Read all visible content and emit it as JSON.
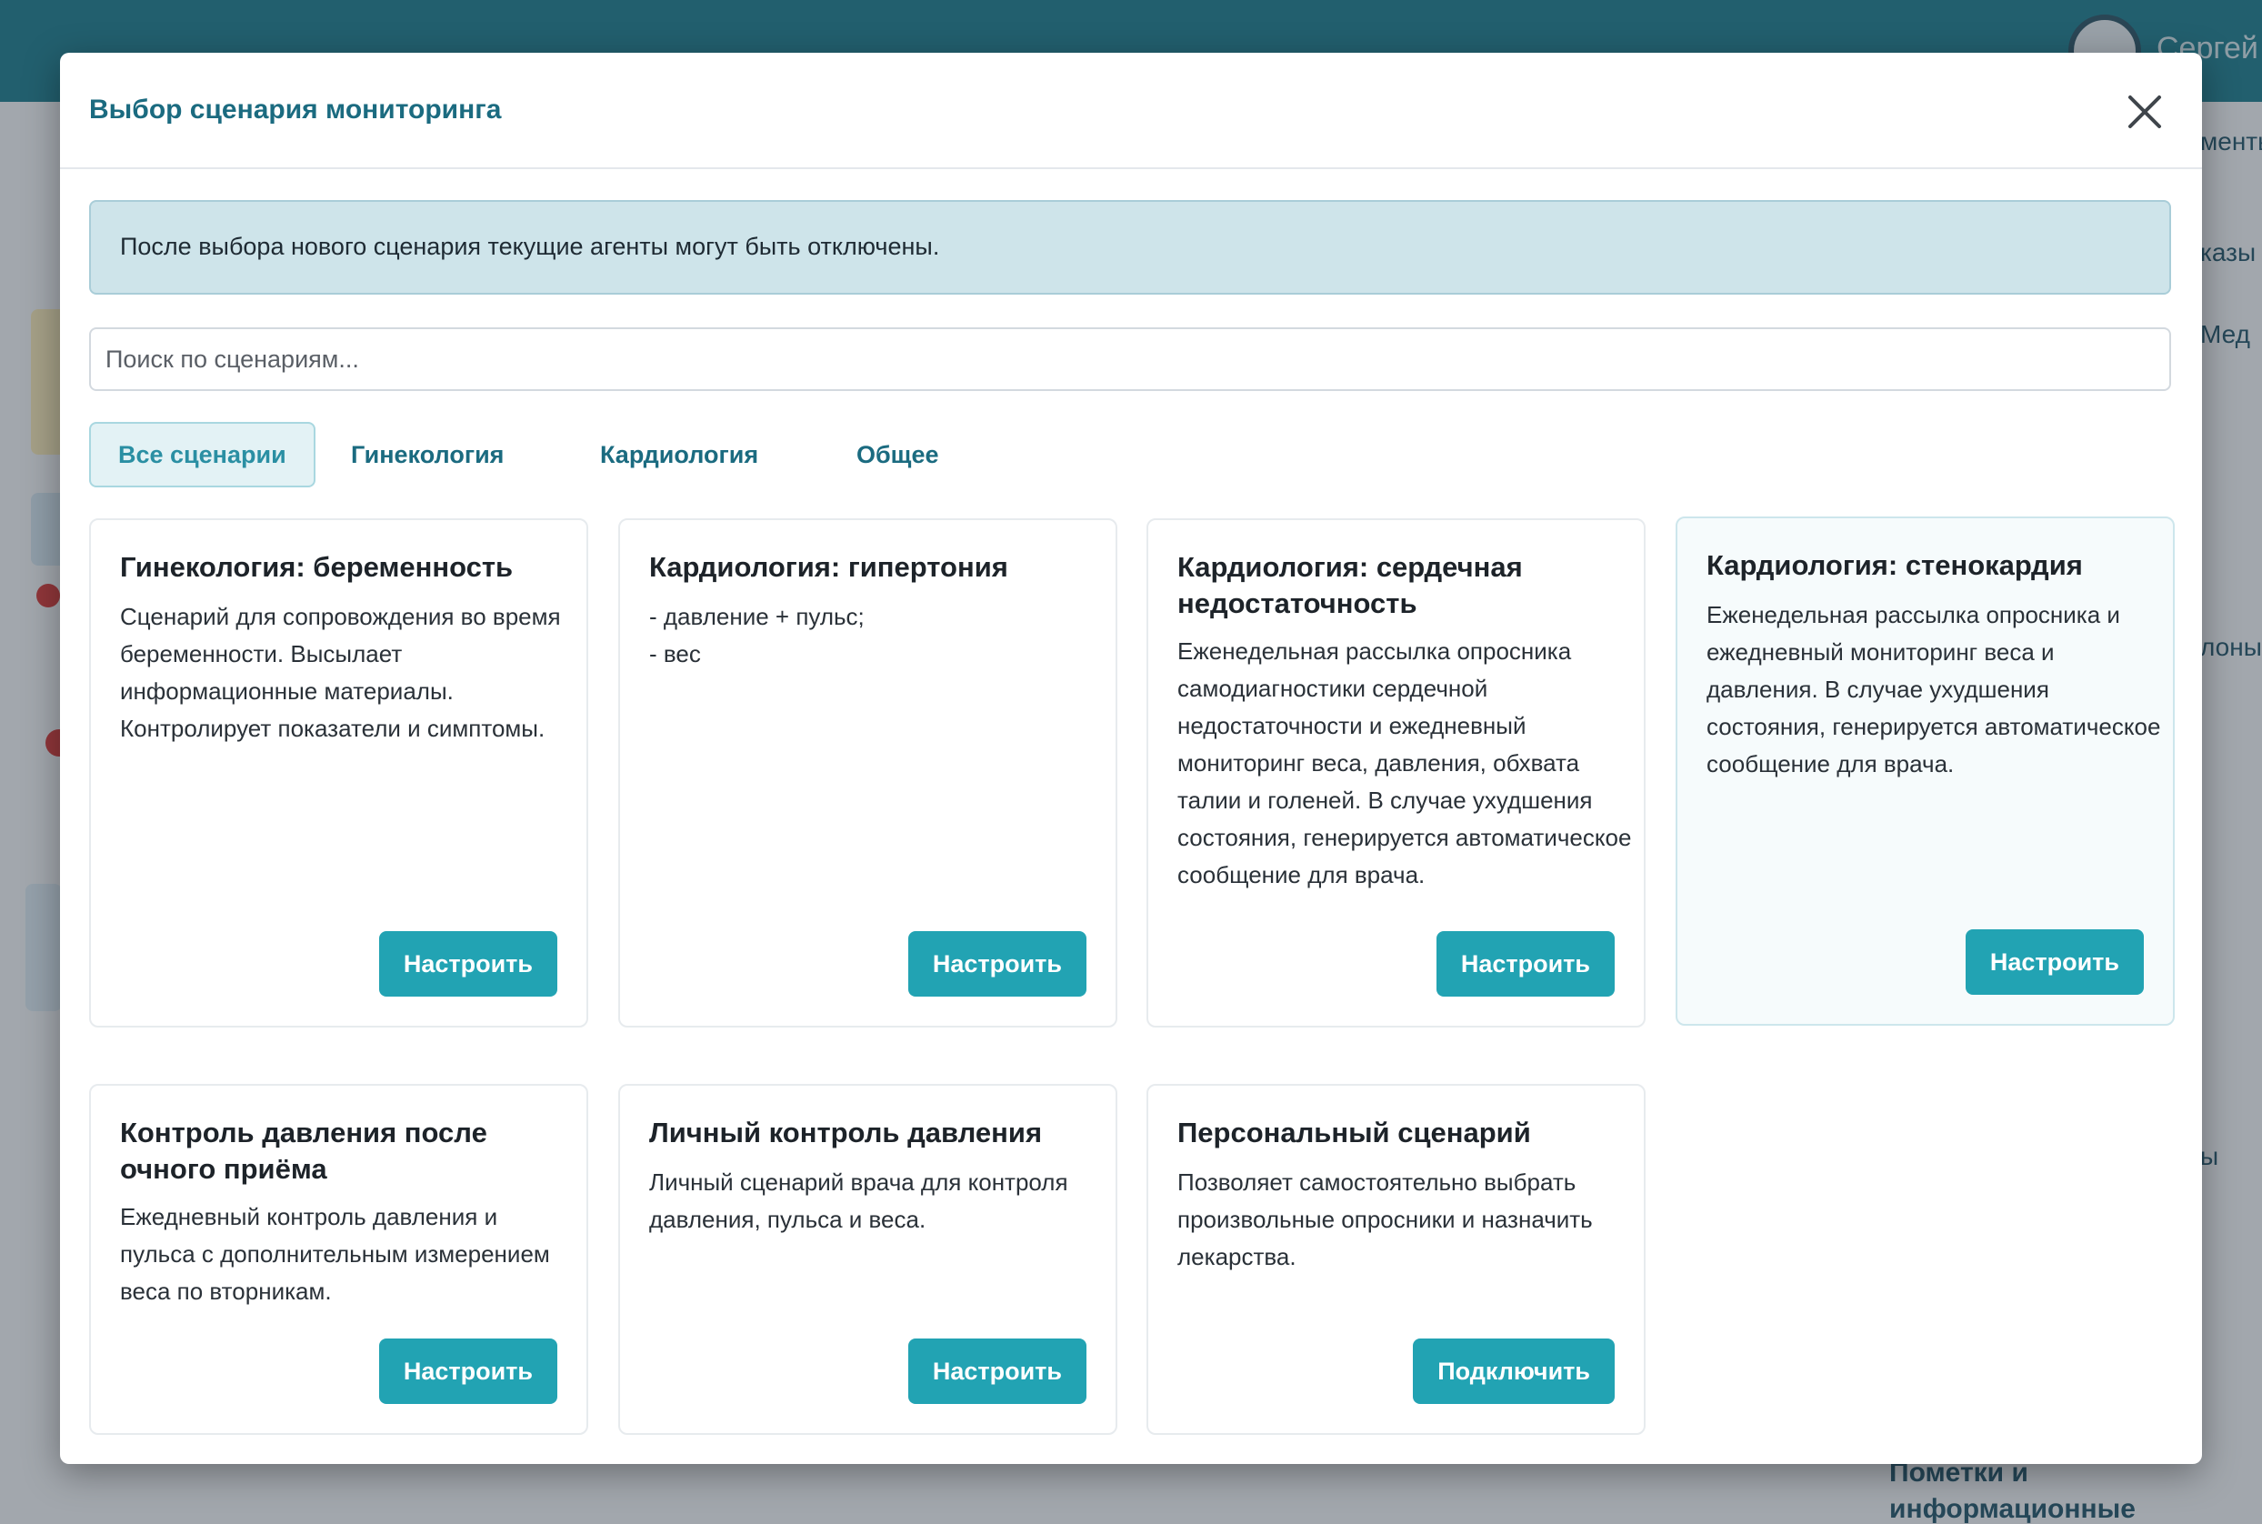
{
  "background": {
    "user_name": "Сергей",
    "side_texts": [
      "менты",
      "казы",
      "Мед",
      "лоны",
      "ы"
    ],
    "bottom_text": "Пометки и информационные материалы"
  },
  "modal": {
    "title": "Выбор сценария мониторинга",
    "close_icon": "close-icon",
    "alert": "После выбора нового сценария текущие агенты могут быть отключены.",
    "search": {
      "placeholder": "Поиск по сценариям...",
      "value": ""
    },
    "tabs": [
      {
        "label": "Все сценарии",
        "active": true
      },
      {
        "label": "Гинекология",
        "active": false
      },
      {
        "label": "Кардиология",
        "active": false
      },
      {
        "label": "Общее",
        "active": false
      }
    ],
    "cards": [
      {
        "title": "Гинекология: беременность",
        "description": "Сценарий для сопровождения во время беременности. Высылает информационные материалы. Контролирует показатели и симптомы.",
        "button": "Настроить"
      },
      {
        "title": "Кардиология: гипертония",
        "description": "- давление + пульс;\n- вес",
        "button": "Настроить"
      },
      {
        "title": "Кардиология: сердечная недостаточность",
        "description": "Еженедельная рассылка опросника самодиагностики сердечной недостаточности и ежедневный мониторинг веса, давления, обхвата талии и голеней. В случае ухудшения состояния, генерируется автоматическое сообщение для врача.",
        "button": "Настроить"
      },
      {
        "title": "Кардиология: стенокардия",
        "description": "Еженедельная рассылка опросника и ежедневный мониторинг веса и давления. В случае ухудшения состояния, генерируется автоматическое сообщение для врача.",
        "button": "Настроить"
      },
      {
        "title": "Контроль давления после очного приёма",
        "description": "Ежедневный контроль давления и пульса с дополнительным измерением веса по вторникам.",
        "button": "Настроить"
      },
      {
        "title": "Личный контроль давления",
        "description": "Личный сценарий врача для контроля давления, пульса и веса.",
        "button": "Настроить"
      },
      {
        "title": "Персональный сценарий",
        "description": "Позволяет самостоятельно выбрать произвольные опросники и назначить лекарства.",
        "button": "Подключить"
      }
    ]
  },
  "colors": {
    "accent": "#22a3b3",
    "title": "#1b6b80",
    "header": "#1f7c8f",
    "alert_bg": "#cee4ea"
  }
}
